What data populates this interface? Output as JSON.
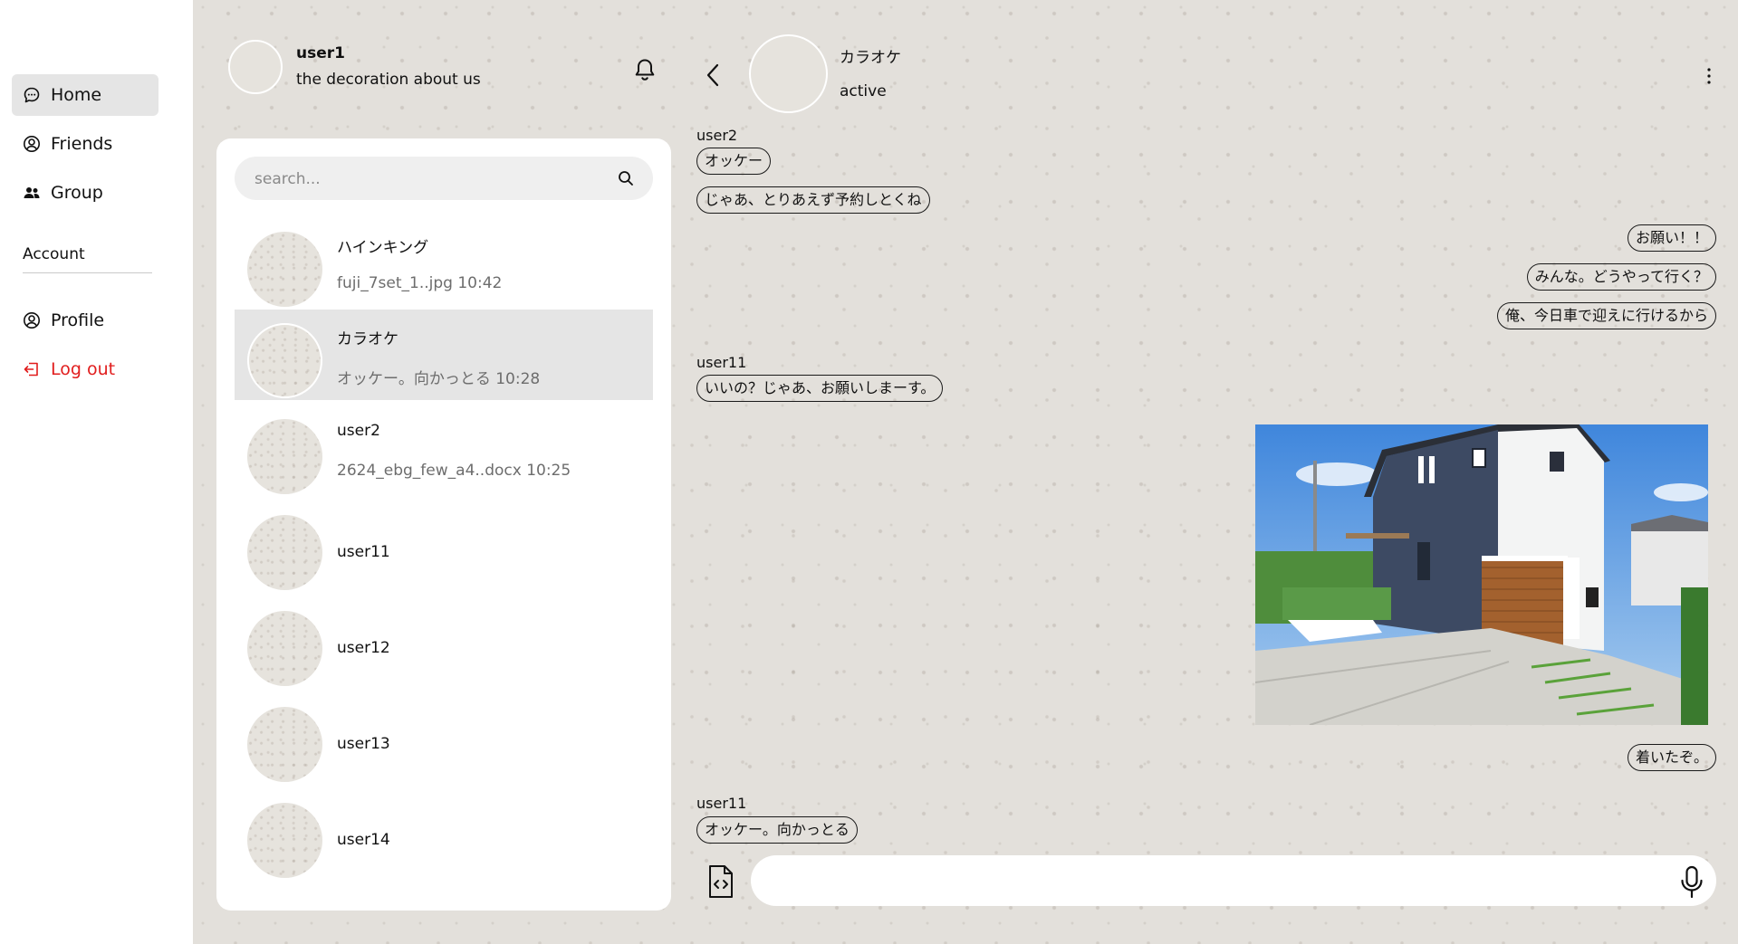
{
  "nav": {
    "items": [
      {
        "label": "Home",
        "icon": "chat-bubble-icon"
      },
      {
        "label": "Friends",
        "icon": "user-circle-icon"
      },
      {
        "label": "Group",
        "icon": "group-icon"
      }
    ],
    "account_label": "Account",
    "account_items": [
      {
        "label": "Profile",
        "icon": "user-circle-icon"
      },
      {
        "label": "Log out",
        "icon": "logout-icon"
      }
    ]
  },
  "me": {
    "name": "user1",
    "status": "the decoration about us"
  },
  "search": {
    "placeholder": "search..."
  },
  "contacts": [
    {
      "name": "ハインキング",
      "last": "fuji_7set_1..jpg 10:42"
    },
    {
      "name": "カラオケ",
      "last": "オッケー。向かっとる 10:28"
    },
    {
      "name": "user2",
      "last": "2624_ebg_few_a4..docx 10:25"
    },
    {
      "name": "user11"
    },
    {
      "name": "user12"
    },
    {
      "name": "user13"
    },
    {
      "name": "user14"
    }
  ],
  "chat": {
    "name": "カラオケ",
    "status": "active",
    "messages": {
      "sender1": "user2",
      "m1": "オッケー",
      "m2": "じゃあ、とりあえず予約しとくね",
      "m3": "お願い！！",
      "m4": "みんな。どうやって行く？",
      "m5": "俺、今日車で迎えに行けるから",
      "sender2": "user11",
      "m6": "いいの？じゃあ、お願いしまーす。",
      "m7": "着いたぞ。",
      "sender3": "user11",
      "m8": "オッケー。向かっとる"
    }
  },
  "colors": {
    "logout": "#e11d1d",
    "selected": "#e5e5e5",
    "panel": "#ffffff"
  }
}
